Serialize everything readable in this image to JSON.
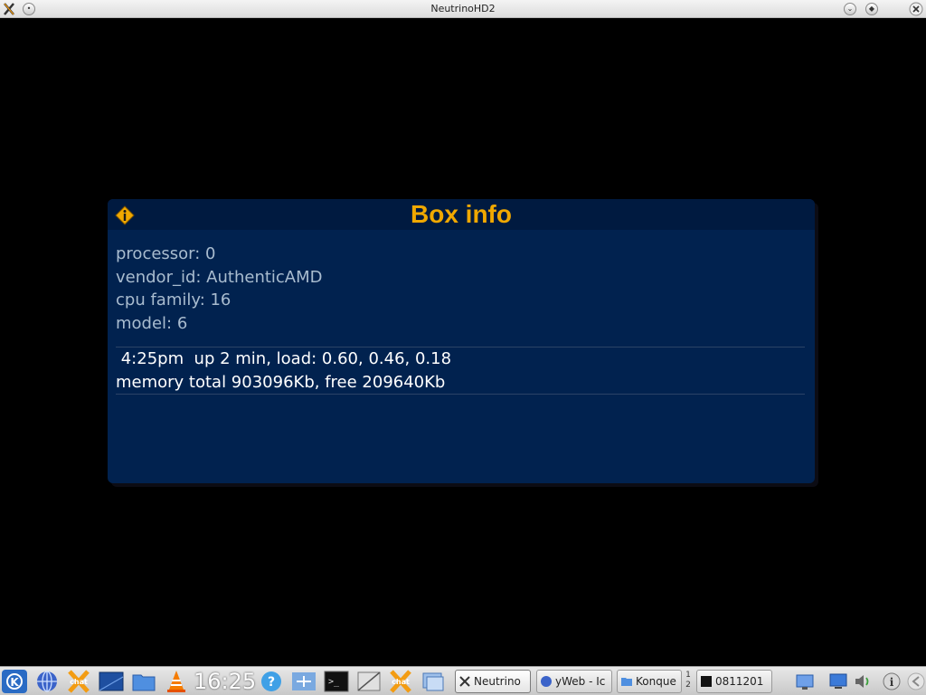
{
  "window": {
    "title": "NeutrinoHD2"
  },
  "dialog": {
    "title": "Box info",
    "cpu_info": [
      "processor: 0",
      "vendor_id: AuthenticAMD",
      "cpu family: 16",
      "model: 6"
    ],
    "uptime": " 4:25pm  up 2 min, load: 0.60, 0.46, 0.18",
    "memory": "memory total 903096Kb, free 209640Kb",
    "colors": {
      "background": "#01224f",
      "title": "#f0a800",
      "cpu_text": "#a9bccf",
      "status_text": "#ffffff"
    }
  },
  "taskbar": {
    "clock": "16:25",
    "tasks": [
      {
        "label": "Neutrino",
        "icon": "x-icon",
        "active": true
      },
      {
        "label": "yWeb - Ic",
        "icon": "globe-icon",
        "active": false
      },
      {
        "label": "Konque",
        "icon": "folder-icon",
        "active": false
      },
      {
        "label": "0811201",
        "icon": "terminal-icon",
        "active": false
      }
    ],
    "pager": [
      "1",
      "2"
    ]
  }
}
